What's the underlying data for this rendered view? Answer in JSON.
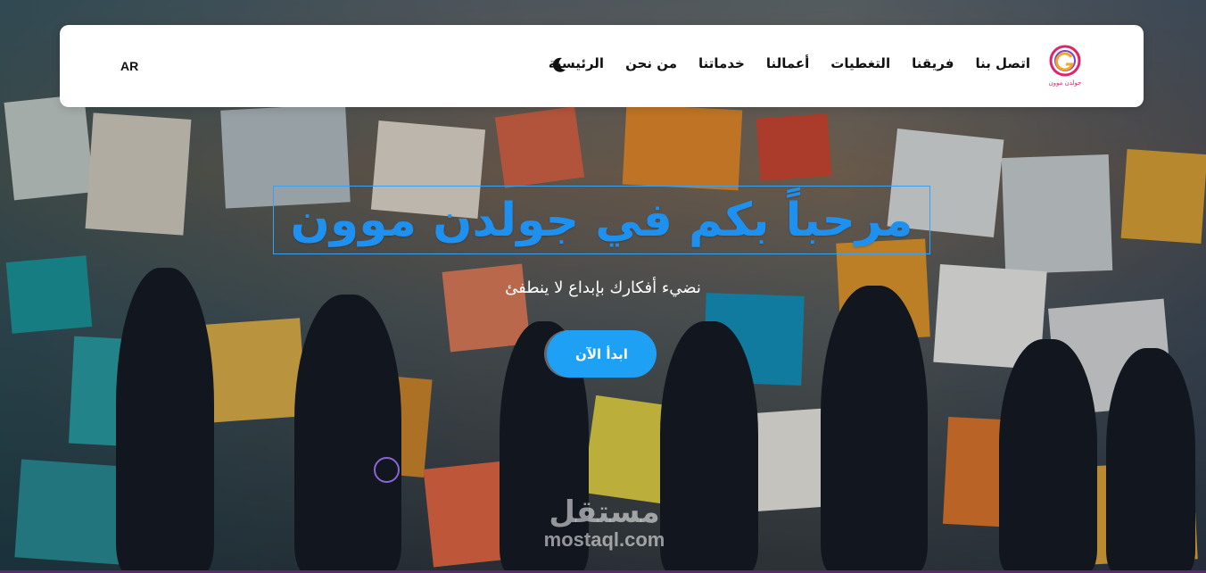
{
  "brand": {
    "logo_text": "جولدن موون",
    "accent_color": "#1e90ef",
    "logo_colors": [
      "#e0246a",
      "#f5a623",
      "#7b3fd1"
    ]
  },
  "nav": {
    "items": [
      {
        "label": "الرئيسية"
      },
      {
        "label": "من نحن"
      },
      {
        "label": "خدماتنا"
      },
      {
        "label": "أعمالنا"
      },
      {
        "label": "التغطيات"
      },
      {
        "label": "فريقنا"
      },
      {
        "label": "اتصل بنا"
      }
    ],
    "theme_toggle_icon": "moon-icon",
    "language_label": "AR"
  },
  "hero": {
    "title": "مرحباً بكم في جولدن موون",
    "subtitle": "نضيء أفكارك بإبداع لا ينطفئ",
    "cta_label": "ابدأ الآن",
    "cta_color": "#1ea0f5"
  },
  "watermark": {
    "arabic": "مستقل",
    "domain": "mostaql.com"
  }
}
